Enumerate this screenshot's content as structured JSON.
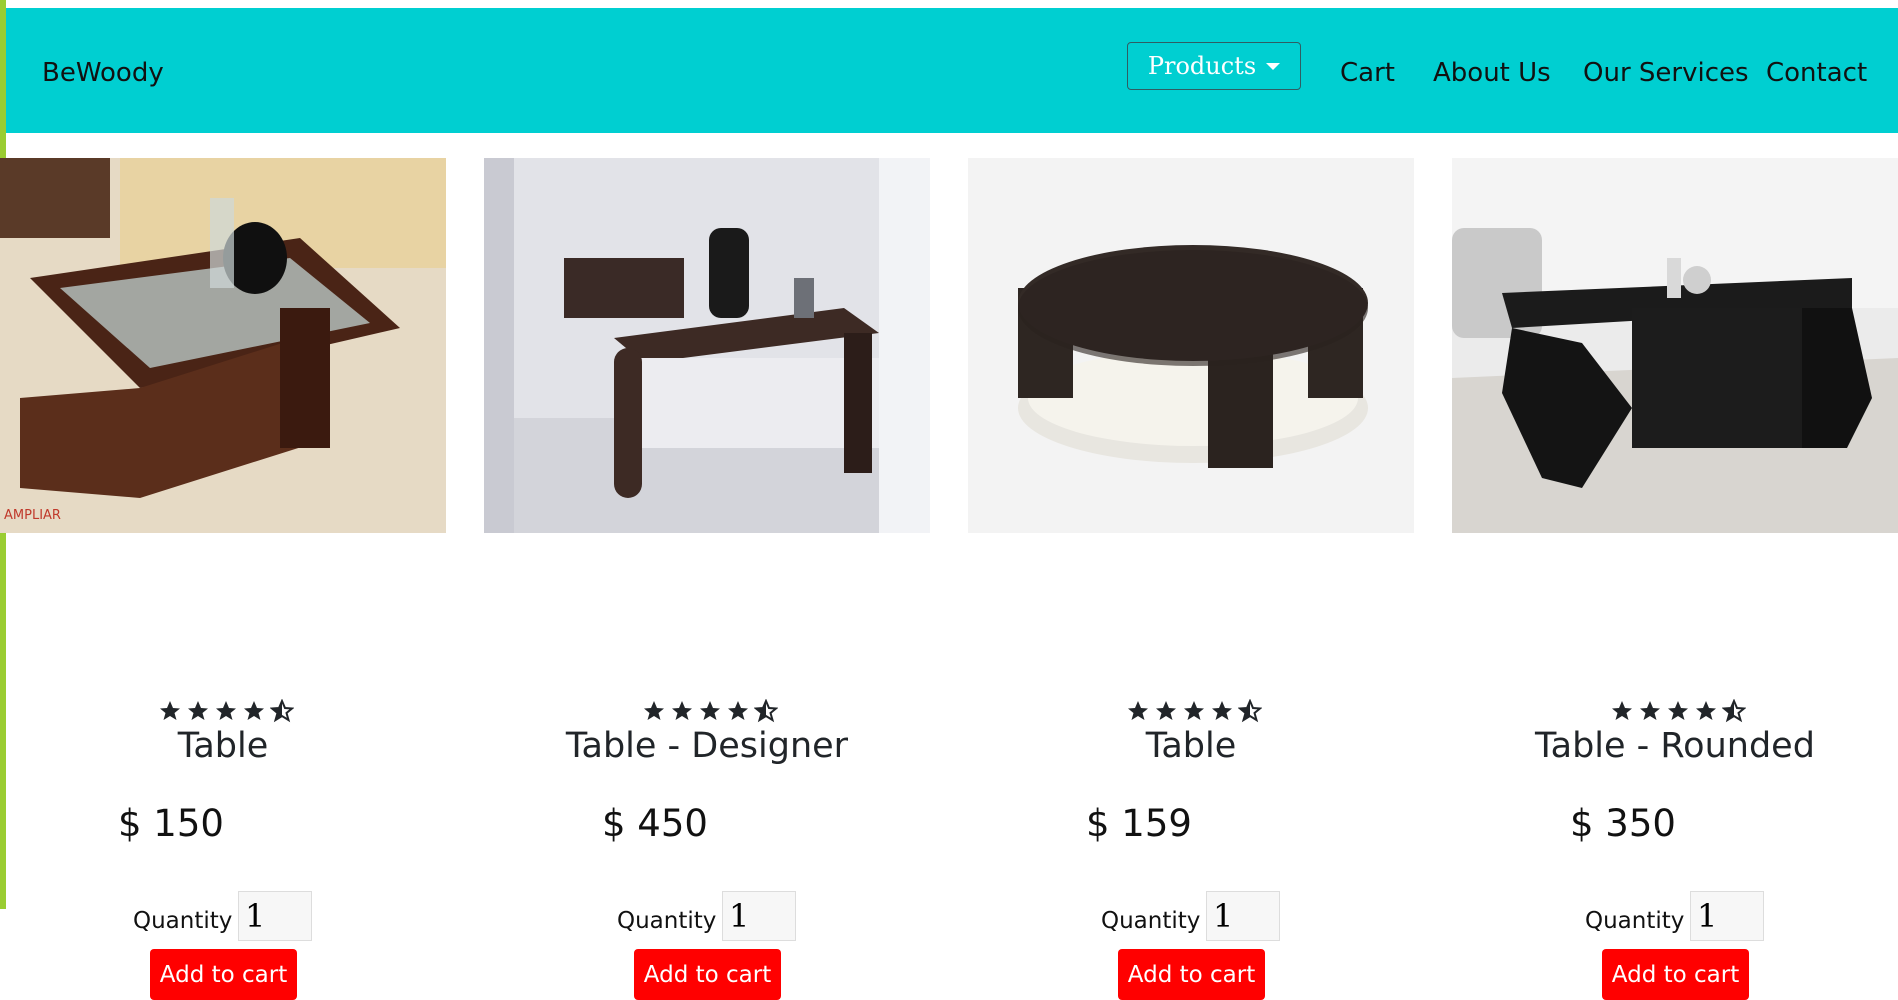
{
  "brand": "BeWoody",
  "nav": {
    "products_label": "Products",
    "cart": "Cart",
    "about": "About Us",
    "services": "Our Services",
    "contact": "Contact"
  },
  "colors": {
    "navbar": "#00cfd1",
    "add_button": "#ff0000",
    "left_accent": "#9acd32"
  },
  "products": [
    {
      "title": "Table",
      "price": "$ 150",
      "rating": 4.5,
      "quantity_label": "Quantity",
      "quantity": "1",
      "button": "Add to cart",
      "image_caption": "AMPLIAR"
    },
    {
      "title": "Table - Designer",
      "price": "$ 450",
      "rating": 4.5,
      "quantity_label": "Quantity",
      "quantity": "1",
      "button": "Add to cart"
    },
    {
      "title": "Table",
      "price": "$ 159",
      "rating": 4.5,
      "quantity_label": "Quantity",
      "quantity": "1",
      "button": "Add to cart"
    },
    {
      "title": "Table - Rounded",
      "price": "$ 350",
      "rating": 4.5,
      "quantity_label": "Quantity",
      "quantity": "1",
      "button": "Add to cart"
    }
  ]
}
